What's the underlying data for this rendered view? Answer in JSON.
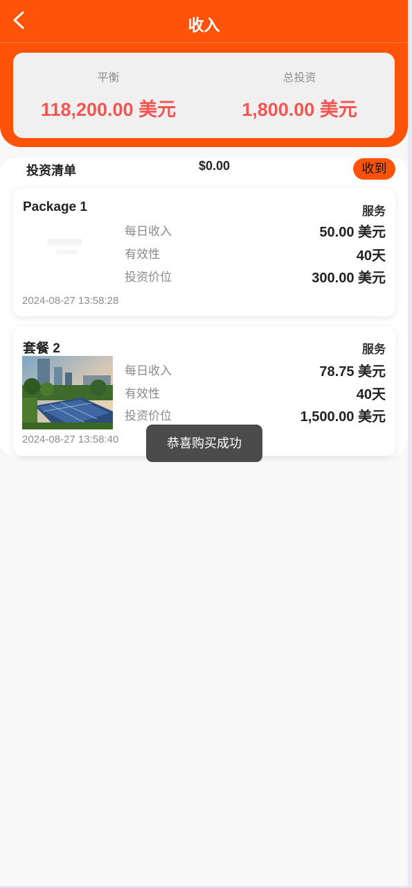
{
  "header": {
    "title": "收入",
    "back_icon": "chevron-left-icon"
  },
  "summary": {
    "balance_label": "平衡",
    "balance_value": "118,200.00 美元",
    "investment_label": "总投资",
    "investment_value": "1,800.00 美元"
  },
  "list": {
    "title": "投资清单",
    "total": "$0.00",
    "collect_label": "收到"
  },
  "packages": [
    {
      "name": "Package 1",
      "service": "服务",
      "daily_label": "每日收入",
      "daily_value": "50.00 美元",
      "validity_label": "有效性",
      "validity_value": "40天",
      "price_label": "投资价位",
      "price_value": "300.00 美元",
      "date": "2024-08-27 13:58:28"
    },
    {
      "name": "套餐 2",
      "service": "服务",
      "daily_label": "每日收入",
      "daily_value": "78.75 美元",
      "validity_label": "有效性",
      "validity_value": "40天",
      "price_label": "投资价位",
      "price_value": "1,500.00 美元",
      "date": "2024-08-27 13:58:40"
    }
  ],
  "toast": {
    "message": "恭喜购买成功"
  },
  "colors": {
    "accent": "#ff5309",
    "value_red": "#f35550",
    "background": "#f8f8f8"
  }
}
